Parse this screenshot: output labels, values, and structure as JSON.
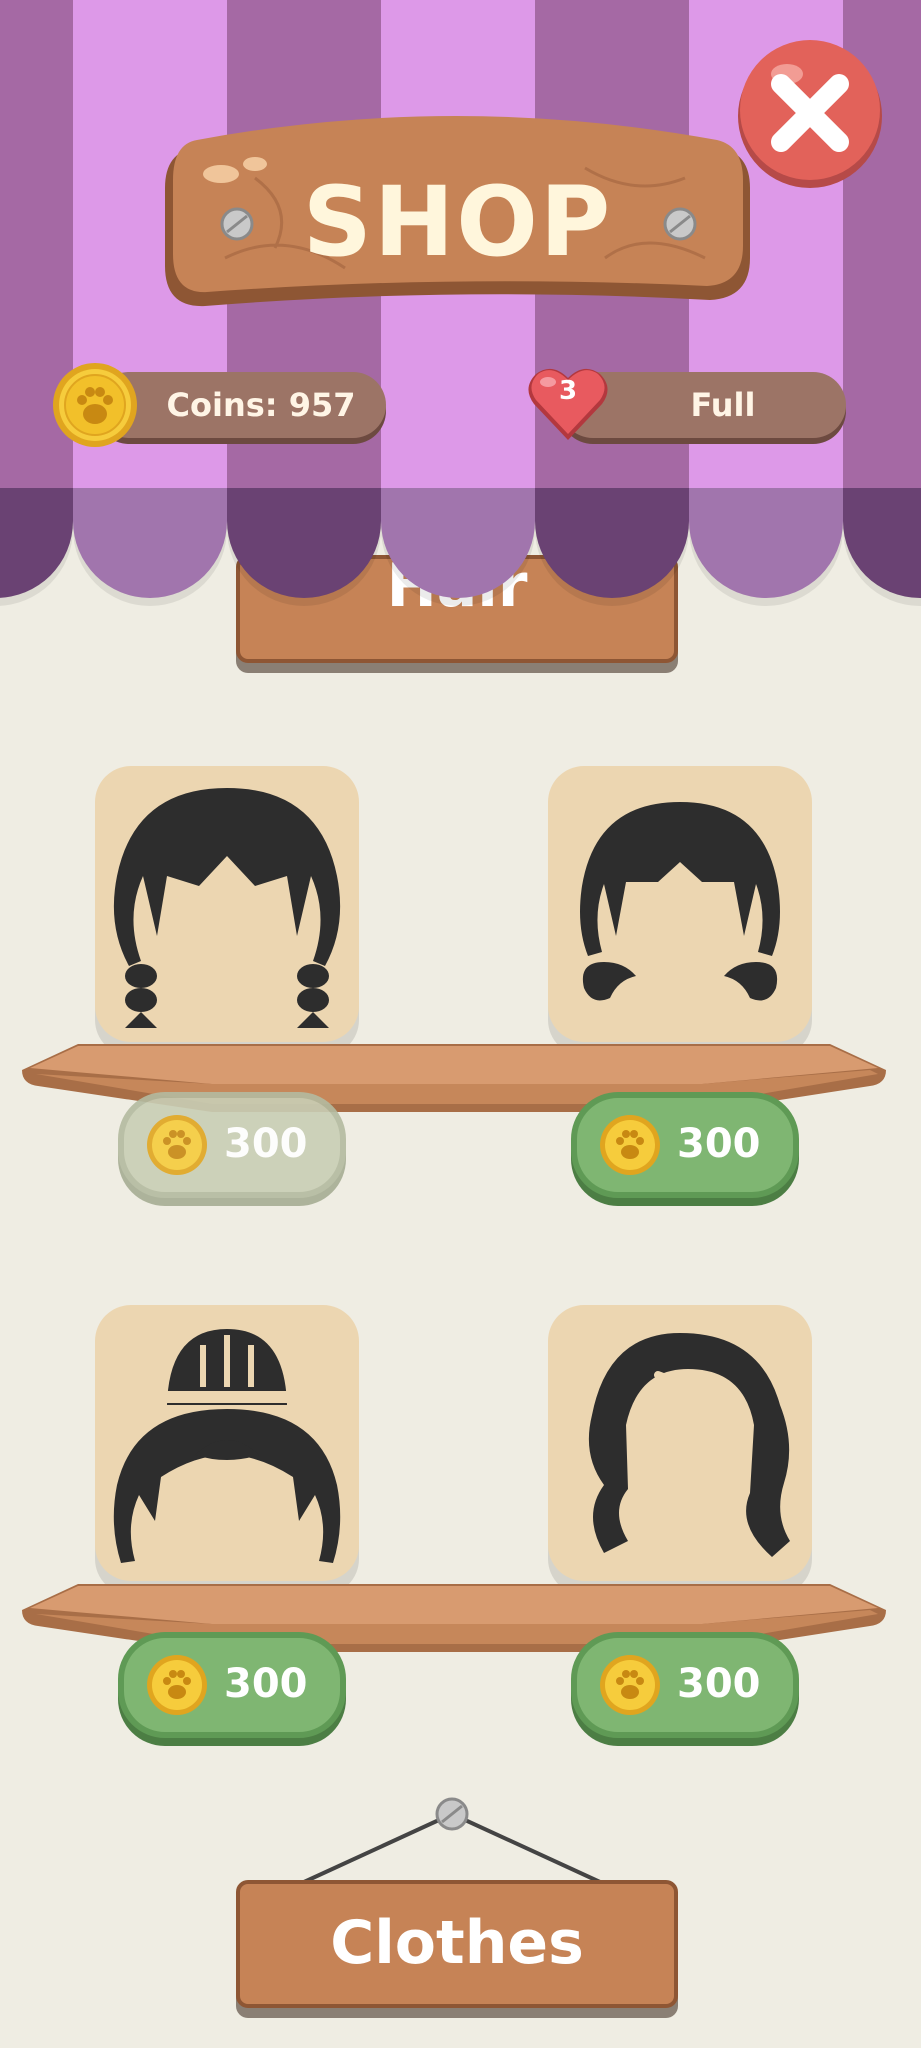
{
  "header": {
    "title": "SHOP"
  },
  "stats": {
    "coins_label": "Coins: 957",
    "lives_count": "3",
    "lives_status": "Full"
  },
  "categories": {
    "current": "Hair",
    "next": "Clothes"
  },
  "items": [
    {
      "name": "braided-pigtails",
      "price": "300",
      "affordable": false
    },
    {
      "name": "short-pigtails",
      "price": "300",
      "affordable": true
    },
    {
      "name": "top-bun",
      "price": "300",
      "affordable": true
    },
    {
      "name": "long-wavy",
      "price": "300",
      "affordable": true
    }
  ],
  "icons": {
    "coin": "paw-coin-icon",
    "heart": "heart-icon",
    "close": "close-icon"
  },
  "colors": {
    "awning_dark": "#a569a4",
    "awning_light": "#dd99e8",
    "wood": "#c68356",
    "price_green": "#7fb672",
    "close_red": "#e2625a",
    "background": "#efede3"
  }
}
